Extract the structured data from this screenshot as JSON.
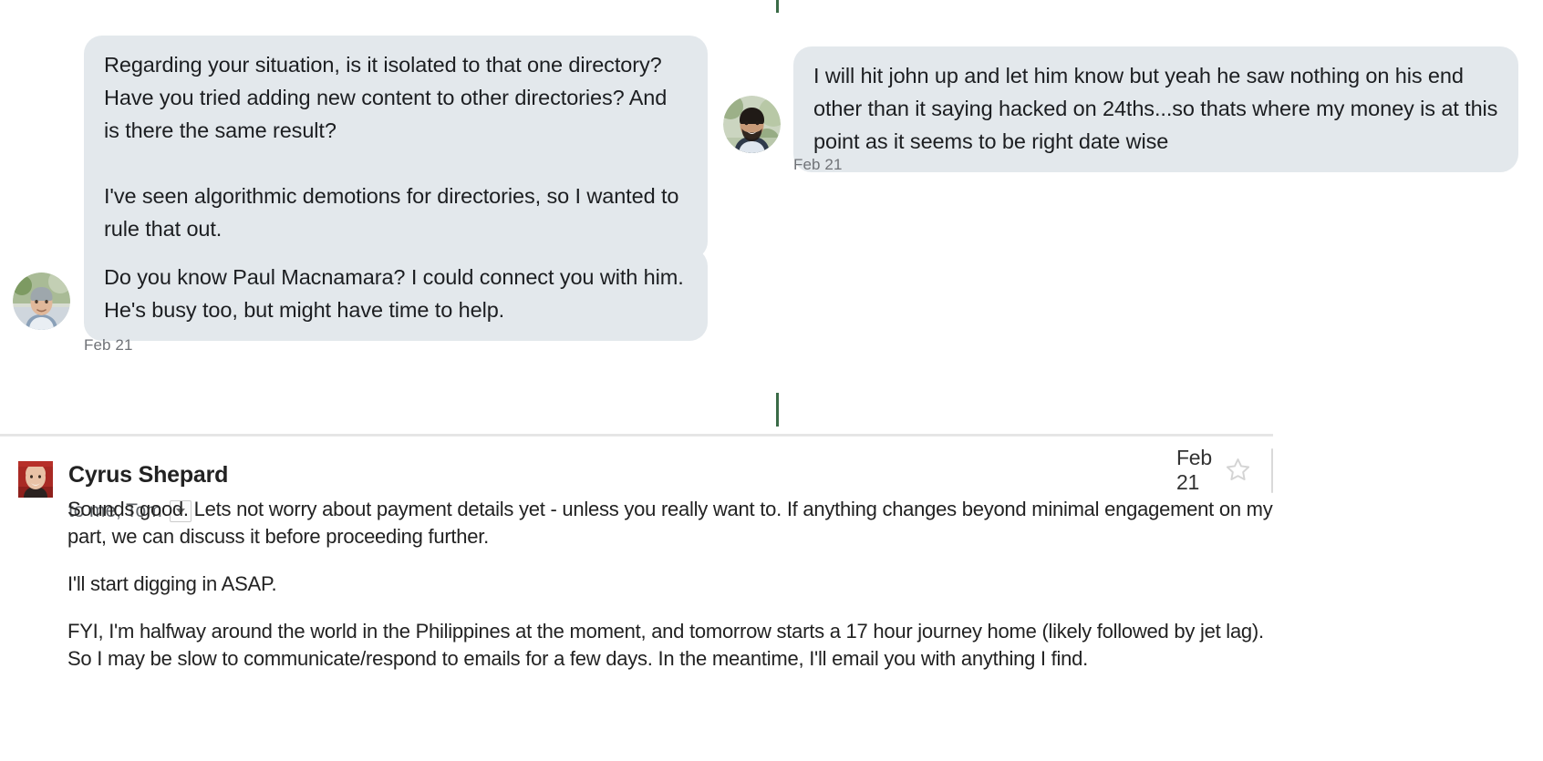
{
  "chat": {
    "messages": [
      {
        "id": "incoming-1",
        "direction": "incoming",
        "text": "Regarding your situation, is it isolated to that one directory? Have you tried adding new content to other directories? And is there the same result?\n\nI've seen algorithmic demotions for directories, so I wanted to rule that out."
      },
      {
        "id": "incoming-2",
        "direction": "incoming",
        "text": "Do you know Paul Macnamara? I could connect you with him. He's busy too, but might have time to help."
      },
      {
        "id": "outgoing-1",
        "direction": "outgoing",
        "text": "I will hit john up and let him know but yeah he saw nothing on his end other than it saying hacked on 24ths...so thats where my money is at this point as it seems to be right date wise"
      }
    ],
    "incoming_timestamp": "Feb 21",
    "outgoing_timestamp": "Feb 21",
    "bubble_color": "#e3e8ec",
    "accent_rule_color": "#3a6b47"
  },
  "email": {
    "sender_name": "Cyrus Shepard",
    "recipients": "to me, Tom",
    "date": "Feb 21",
    "body_paragraphs": [
      "Sounds good. Lets not worry about payment details yet - unless you really want to. If anything changes beyond minimal engagement on my part, we can discuss it before proceeding further.",
      "I'll start digging in ASAP.",
      "FYI, I'm halfway around the world in the Philippines at the moment, and tomorrow starts a 17 hour journey home (likely followed by jet lag). So I may be slow to communicate/respond to emails for a few days. In the meantime, I'll email you with anything I find."
    ],
    "icons": {
      "expander": "chevron-down-icon",
      "star": "star-outline-icon",
      "reply": "reply-arrow-icon",
      "more": "chevron-down-icon"
    }
  }
}
